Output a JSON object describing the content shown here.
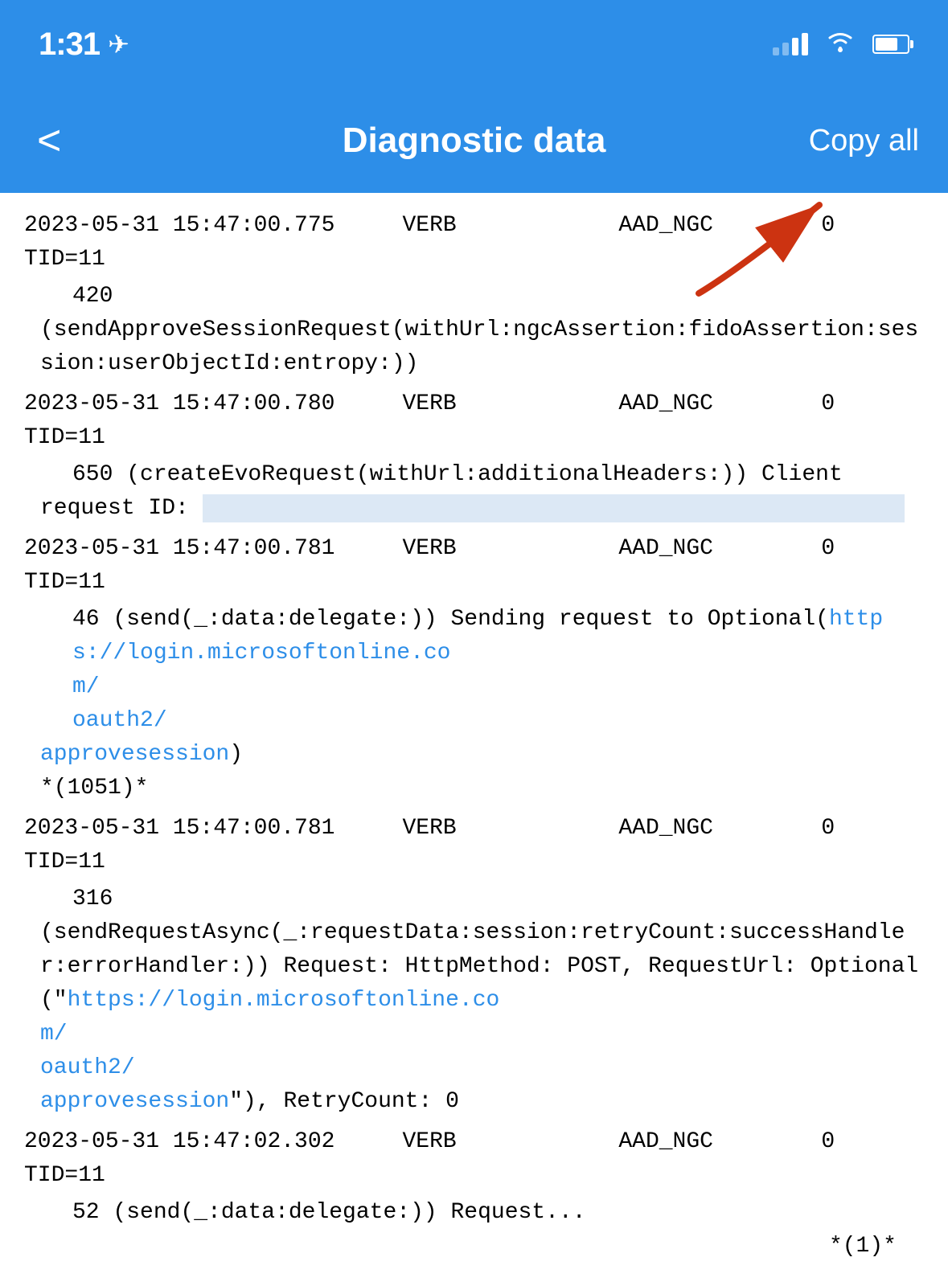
{
  "statusBar": {
    "time": "1:31",
    "locationIcon": "▶",
    "wifiIcon": "wifi"
  },
  "navBar": {
    "backLabel": "<",
    "title": "Diagnostic data",
    "copyAllLabel": "Copy all"
  },
  "logEntries": [
    {
      "id": 1,
      "timestamp": "2023-05-31 15:47:00.775",
      "level": "VERB",
      "module": "AAD_NGC",
      "count": "0",
      "tid": "TID=11",
      "body": "420",
      "detail": "(sendApproveSessionRequest(withUrl:ngcAssertion:fidoAssertion:session:userObjectId:entropy:))",
      "hasHighlight": false
    },
    {
      "id": 2,
      "timestamp": "2023-05-31 15:47:00.780",
      "level": "VERB",
      "module": "AAD_NGC",
      "count": "0",
      "tid": "TID=11",
      "body": "650 (createEvoRequest(withUrl:additionalHeaders:)) Client",
      "detail": "request ID:",
      "hasHighlight": true
    },
    {
      "id": 3,
      "timestamp": "2023-05-31 15:47:00.781",
      "level": "VERB",
      "module": "AAD_NGC",
      "count": "0",
      "tid": "TID=11",
      "body": "46 (send(_:data:delegate:)) Sending request to Optional(",
      "link1": "https://login.microsoftonline.com/oauth2/approvesession",
      "detail": ")",
      "detail2": "*(1051)*",
      "hasHighlight": false,
      "hasLink": true
    },
    {
      "id": 4,
      "timestamp": "2023-05-31 15:47:00.781",
      "level": "VERB",
      "module": "AAD_NGC",
      "count": "0",
      "tid": "TID=11",
      "body": "316",
      "detail": "(sendRequestAsync(_:requestData:session:retryCount:successHandler:errorHandler:)) Request: HttpMethod: POST, RequestUrl: Optional(\"",
      "link2": "https://login.microsoftonline.com/oauth2/approvesession",
      "detail3": "\"), RetryCount: 0",
      "hasHighlight": false,
      "hasLink2": true
    },
    {
      "id": 5,
      "timestamp": "2023-05-31 15:47:02.302",
      "level": "VERB",
      "module": "AAD_NGC",
      "count": "0",
      "tid": "TID=11",
      "body": "52 (send(_:data:delegate:)) Request...",
      "detail": "*(1)*",
      "hasHighlight": false
    }
  ]
}
